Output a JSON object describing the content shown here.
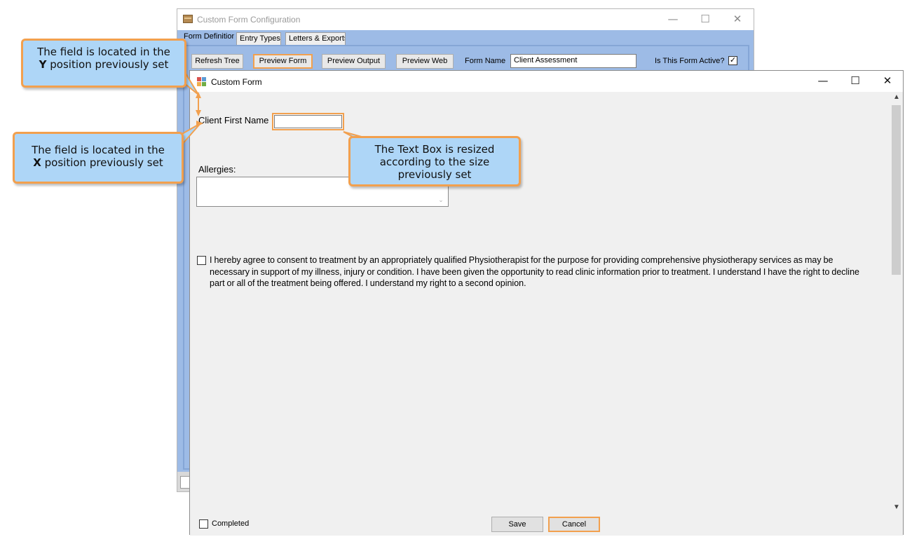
{
  "config_window": {
    "title": "Custom Form Configuration",
    "controls": {
      "minimize": "—",
      "maximize": "☐",
      "close": "✕"
    },
    "tabs": [
      {
        "label": "Form Definition",
        "active": true
      },
      {
        "label": "Entry Types",
        "active": false
      },
      {
        "label": "Letters & Exports",
        "active": false
      }
    ],
    "toolbar": {
      "refresh_tree": "Refresh Tree",
      "preview_form": "Preview Form",
      "preview_output": "Preview Output",
      "preview_web": "Preview Web",
      "form_name_label": "Form Name",
      "form_name_value": "Client Assessment",
      "active_label": "Is This Form Active?",
      "active_checked": true
    }
  },
  "form_window": {
    "title": "Custom Form",
    "controls": {
      "minimize": "—",
      "maximize": "☐",
      "close": "✕"
    },
    "fields": {
      "first_name_label": "Client First Name",
      "first_name_value": "",
      "allergies_label": "Allergies:",
      "allergies_value": ""
    },
    "consent": {
      "checked": false,
      "text": "I hereby agree to consent to treatment by an appropriately qualified Physiotherapist for the purpose for providing comprehensive physiotherapy services as may be necessary in support of my illness, injury or condition.  I have been given the opportunity to read clinic information prior to treatment.  I understand I have the right to decline part or all of the treatment being offered.  I understand my right to a second opinion."
    },
    "footer": {
      "completed_label": "Completed",
      "completed_checked": false,
      "save_label": "Save",
      "cancel_label": "Cancel"
    }
  },
  "annotations": {
    "y_pos_line1": "The field is located in the",
    "y_pos_axis": "Y",
    "y_pos_line2": " position previously set",
    "x_pos_line1": "The field is located in the",
    "x_pos_axis": "X",
    "x_pos_line2": " position previously set",
    "resize_text": "The Text Box is resized according to the size previously set",
    "accent_color": "#f2a04e",
    "callout_color": "#aed6f7"
  }
}
